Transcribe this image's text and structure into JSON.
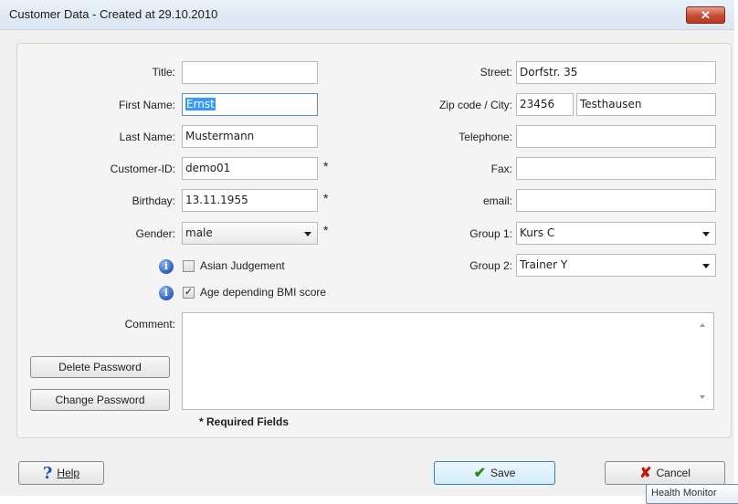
{
  "window": {
    "title": "Customer Data - Created at 29.10.2010",
    "close_glyph": "✕"
  },
  "left_form": {
    "title_label": "Title:",
    "title_value": "",
    "first_name_label": "First Name:",
    "first_name_value": "Ernst",
    "last_name_label": "Last Name:",
    "last_name_value": "Mustermann",
    "customer_id_label": "Customer-ID:",
    "customer_id_value": "demo01",
    "birthday_label": "Birthday:",
    "birthday_value": "13.11.1955",
    "gender_label": "Gender:",
    "gender_value": "male",
    "required_mark": "*"
  },
  "right_form": {
    "street_label": "Street:",
    "street_value": "Dorfstr. 35",
    "zip_city_label": "Zip code / City:",
    "zip_value": "23456",
    "city_value": "Testhausen",
    "telephone_label": "Telephone:",
    "telephone_value": "",
    "fax_label": "Fax:",
    "fax_value": "",
    "email_label": "email:",
    "email_value": "",
    "group1_label": "Group 1:",
    "group1_value": "Kurs C",
    "group2_label": "Group 2:",
    "group2_value": "Trainer Y"
  },
  "options": {
    "asian_judgement_label": "Asian Judgement",
    "asian_judgement_checked": false,
    "bmi_label": "Age depending BMI score",
    "bmi_checked": true,
    "check_glyph": "✓",
    "info_glyph": "i"
  },
  "comment": {
    "label": "Comment:",
    "value": ""
  },
  "buttons": {
    "delete_password": "Delete Password",
    "change_password": "Change Password",
    "help": "Help",
    "help_glyph": "?",
    "save": "Save",
    "save_glyph": "✔",
    "cancel": "Cancel",
    "cancel_glyph": "✘"
  },
  "required_note": "* Required Fields",
  "tooltip": "Health Monitor",
  "colors": {
    "selection": "#3399ff",
    "save_border": "#3c7fb1",
    "close_red": "#c74a34"
  }
}
